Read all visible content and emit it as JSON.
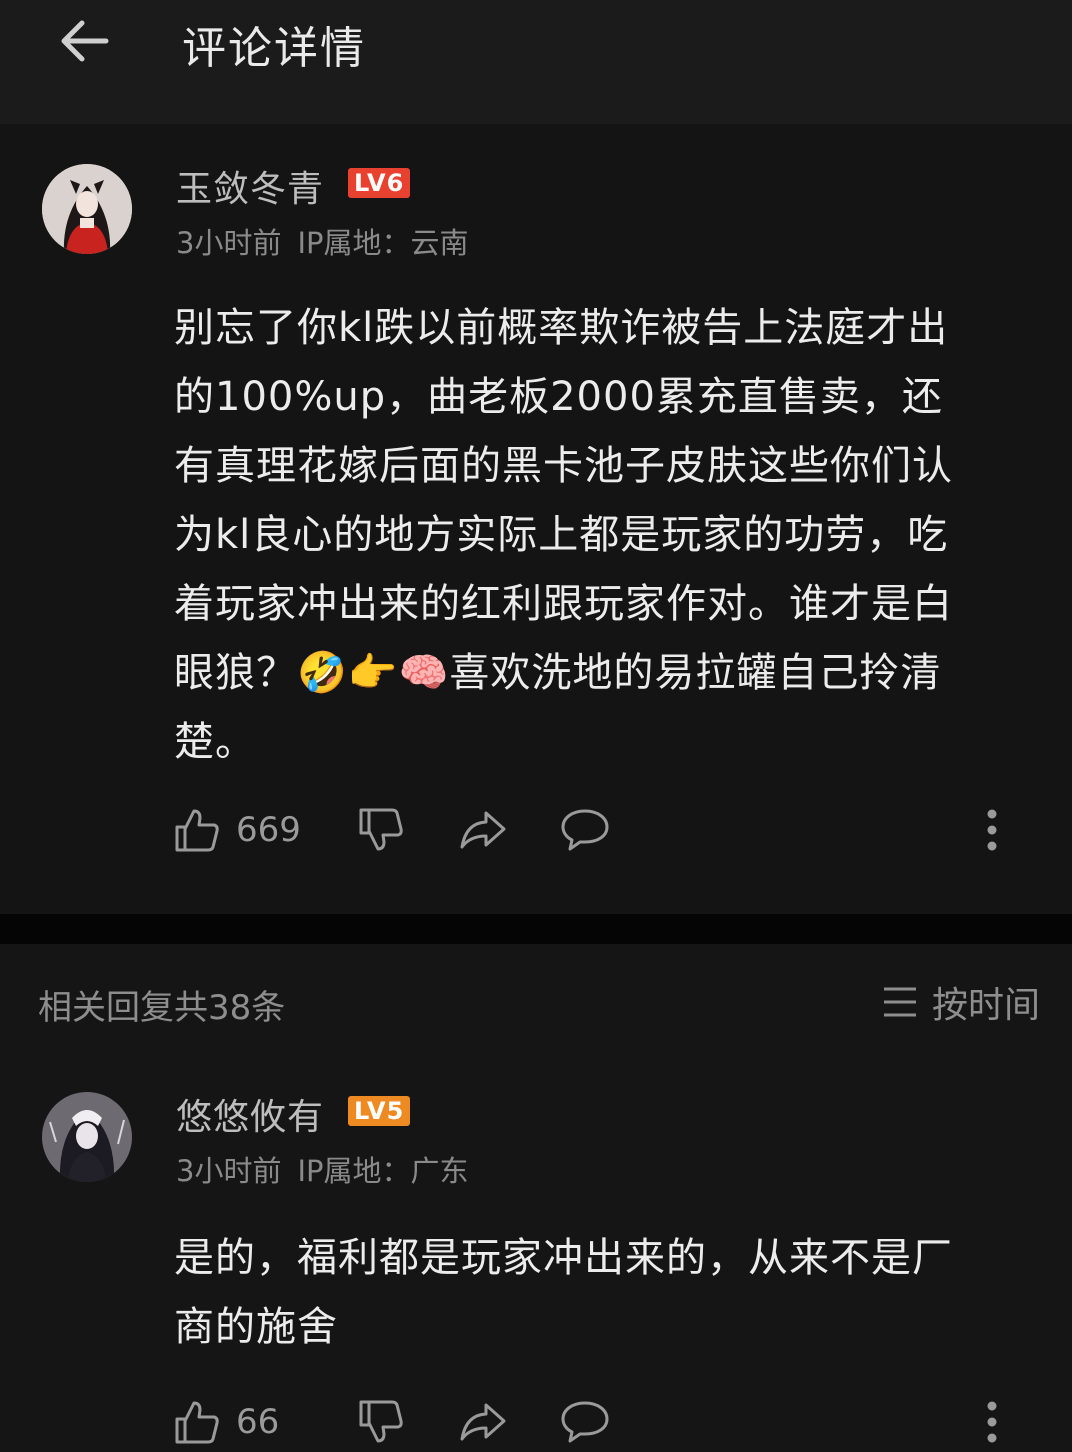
{
  "header": {
    "title": "评论详情",
    "back_icon": "arrow-left-icon"
  },
  "main_comment": {
    "user_name": "玉敛冬青",
    "level": "LV6",
    "level_color": "#e8412f",
    "time": "3小时前",
    "ip": "IP属地：云南",
    "text": "别忘了你kl跌以前概率欺诈被告上法庭才出\n的100%up，曲老板2000累充直售卖，还\n有真理花嫁后面的黑卡池子皮肤这些你们认\n为kl良心的地方实际上都是玩家的功劳，吃\n着玩家冲出来的红利跟玩家作对。谁才是白\n眼狼？🤣👉🧠喜欢洗地的易拉罐自己拎清\n楚。",
    "like_count": "669",
    "icons": [
      "thumb-up-icon",
      "thumb-down-icon",
      "share-icon",
      "comment-icon",
      "more-icon"
    ]
  },
  "replies_header": {
    "count_label": "相关回复共38条",
    "sort_label": "按时间",
    "sort_icon": "menu-lines-icon"
  },
  "replies": [
    {
      "user_name": "悠悠攸有",
      "level": "LV5",
      "level_color": "#ee8a22",
      "time": "3小时前",
      "ip": "IP属地：广东",
      "text": "是的，福利都是玩家冲出来的，从来不是厂\n商的施舍",
      "like_count": "66"
    }
  ],
  "colors": {
    "background": "#151515",
    "header": "#1b1b1b",
    "text_primary": "#ececec",
    "text_secondary": "#8a8a8a"
  }
}
